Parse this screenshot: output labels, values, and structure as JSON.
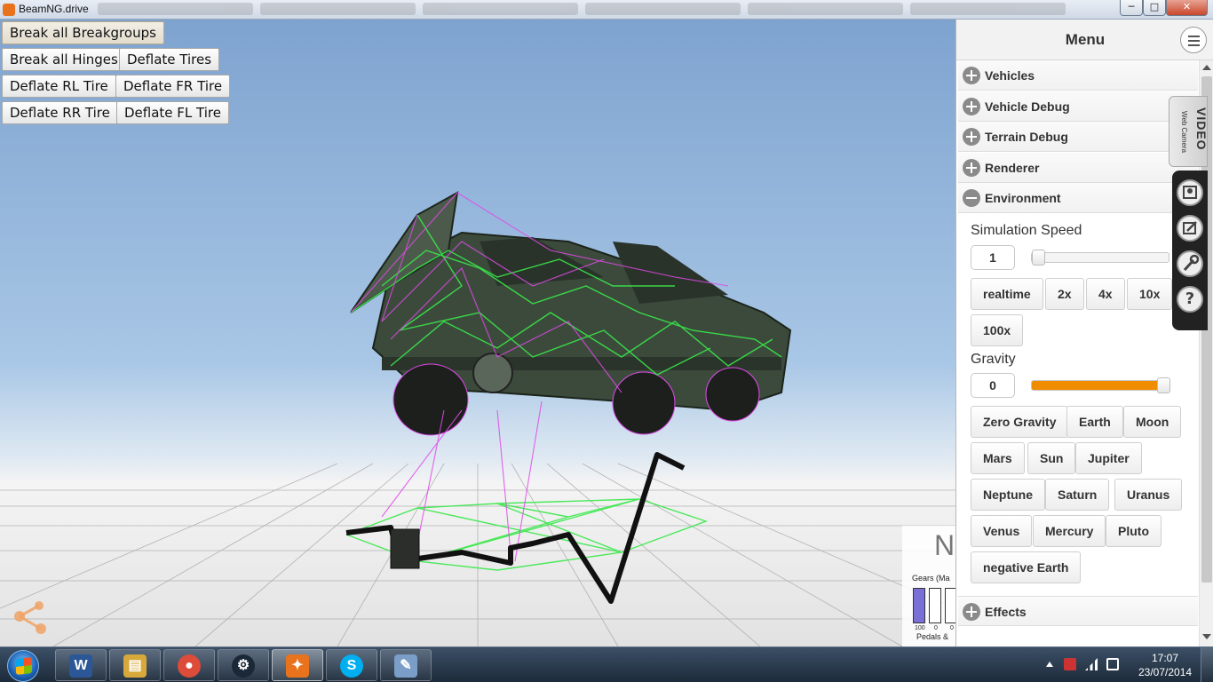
{
  "window": {
    "title": "BeamNG.drive",
    "minimize_label": "─",
    "maximize_label": "□",
    "close_label": "✕"
  },
  "debug_buttons": [
    {
      "label": "Break all Breakgroups",
      "pressed": true
    },
    {
      "label": "Break all Hinges"
    },
    {
      "label": "Deflate Tires"
    },
    {
      "label": "Deflate RL Tire"
    },
    {
      "label": "Deflate FR Tire"
    },
    {
      "label": "Deflate RR Tire"
    },
    {
      "label": "Deflate FL Tire"
    }
  ],
  "gear_widget": {
    "big_letter": "N",
    "gears_label": "Gears (Ma",
    "bar_values": [
      "100",
      "0",
      "0"
    ],
    "pedals_label": "Pedals &"
  },
  "menu": {
    "title": "Menu",
    "items": [
      {
        "label": "Vehicles",
        "icon": "plus-circle-icon"
      },
      {
        "label": "Vehicle Debug",
        "icon": "plus-circle-icon"
      },
      {
        "label": "Terrain Debug",
        "icon": "plus-circle-icon"
      },
      {
        "label": "Renderer",
        "icon": "plus-circle-icon"
      },
      {
        "label": "Environment",
        "icon": "minus-circle-icon"
      }
    ],
    "environment": {
      "sim_speed_label": "Simulation Speed",
      "sim_speed_value": "1",
      "sim_speed_slider": 0.0,
      "speed_buttons": [
        "realtime",
        "2x",
        "4x",
        "10x",
        "100x"
      ],
      "gravity_label": "Gravity",
      "gravity_value": "0",
      "gravity_slider": 0.97,
      "gravity_buttons": [
        "Zero Gravity",
        "Earth",
        "Moon",
        "Mars",
        "Sun",
        "Jupiter",
        "Neptune",
        "Saturn",
        "Uranus",
        "Venus",
        "Mercury",
        "Pluto",
        "negative Earth"
      ]
    },
    "effects_label": "Effects"
  },
  "side_toolbar": {
    "video_label": "VIDEO",
    "video_sub": "Web Camera",
    "tools": [
      "user-icon",
      "edit-icon",
      "wrench-icon",
      "help-icon"
    ],
    "help_glyph": "?"
  },
  "taskbar": {
    "apps": [
      {
        "name": "word-icon",
        "glyph": "W",
        "color": "#2b5797"
      },
      {
        "name": "explorer-icon",
        "glyph": "▤",
        "color": "#d8a93a"
      },
      {
        "name": "chrome-icon",
        "glyph": "●",
        "color": "#dd4b39"
      },
      {
        "name": "steam-icon",
        "glyph": "⚙",
        "color": "#1b2838"
      },
      {
        "name": "beamng-icon",
        "glyph": "✦",
        "color": "#e8731c",
        "active": true
      },
      {
        "name": "skype-icon",
        "glyph": "S",
        "color": "#00aff0"
      },
      {
        "name": "paint-icon",
        "glyph": "✎",
        "color": "#7b9ec9"
      }
    ],
    "time": "17:07",
    "date": "23/07/2014"
  },
  "colors": {
    "accent_orange": "#f08c00",
    "wire_green": "#39e84a",
    "wire_magenta": "#e04be8"
  }
}
